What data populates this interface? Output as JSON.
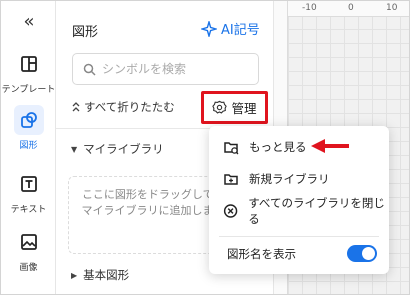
{
  "rail": {
    "collapse_glyph": "«",
    "items": [
      {
        "label": "テンプレート",
        "icon": "template-icon"
      },
      {
        "label": "図形",
        "icon": "shapes-icon",
        "active": true
      },
      {
        "label": "テキスト",
        "icon": "text-icon"
      },
      {
        "label": "画像",
        "icon": "image-icon"
      }
    ]
  },
  "panel": {
    "title": "図形",
    "ai_label": "AI記号",
    "search_placeholder": "シンボルを検索",
    "collapse_all": "すべて折りたたむ",
    "manage_label": "管理",
    "my_library": "マイライブラリ",
    "drop_hint": "ここに図形をドラッグして、マイライブラリに追加します",
    "basic_shapes": "基本図形"
  },
  "ruler": {
    "labels": [
      "-10",
      "0",
      "10"
    ]
  },
  "menu": {
    "items": [
      {
        "label": "もっと見る",
        "icon": "library-more-icon"
      },
      {
        "label": "新規ライブラリ",
        "icon": "new-library-icon"
      },
      {
        "label": "すべてのライブラリを閉じる",
        "icon": "close-circle-icon"
      }
    ],
    "show_names_label": "図形名を表示",
    "show_names_on": true
  },
  "colors": {
    "accent": "#1a73e8",
    "highlight": "#e0141e"
  }
}
